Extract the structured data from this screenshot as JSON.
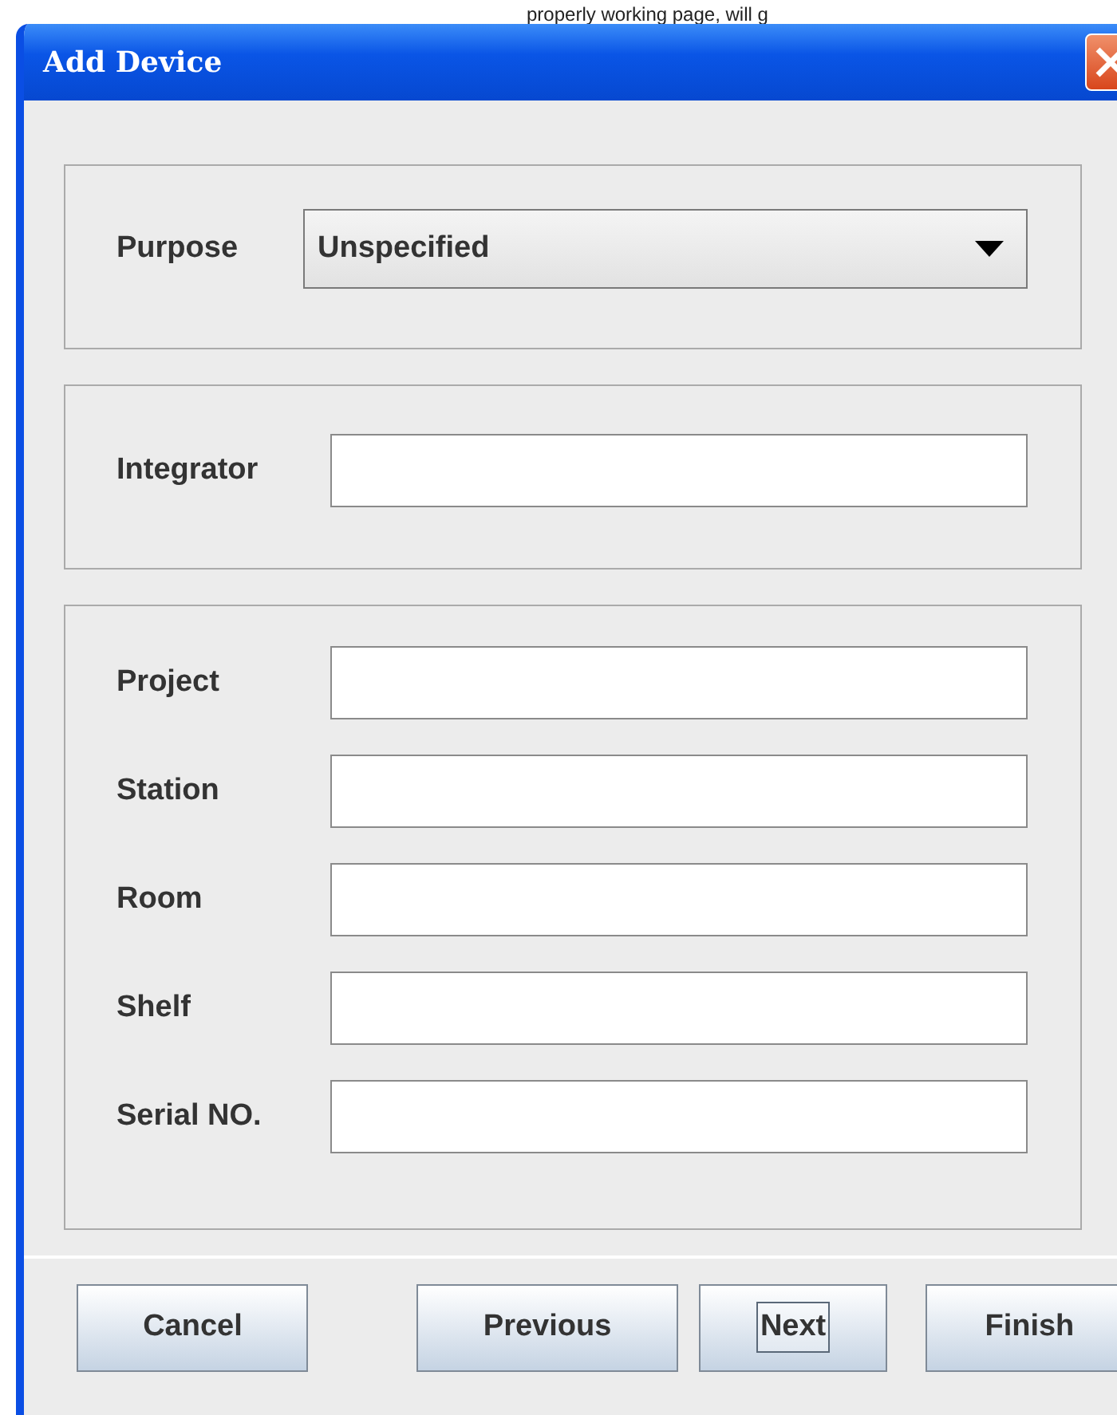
{
  "background_text": "properly working page, will g",
  "window": {
    "title": "Add Device"
  },
  "purpose": {
    "label": "Purpose",
    "value": "Unspecified"
  },
  "integrator": {
    "label": "Integrator"
  },
  "fields": [
    {
      "label": "Project"
    },
    {
      "label": "Station"
    },
    {
      "label": "Room"
    },
    {
      "label": "Shelf"
    },
    {
      "label": "Serial NO."
    }
  ],
  "buttons": [
    {
      "label": "Cancel",
      "focused": false
    },
    {
      "label": "Previous",
      "focused": false
    },
    {
      "label": "Next",
      "focused": true
    },
    {
      "label": "Finish",
      "focused": false
    }
  ]
}
